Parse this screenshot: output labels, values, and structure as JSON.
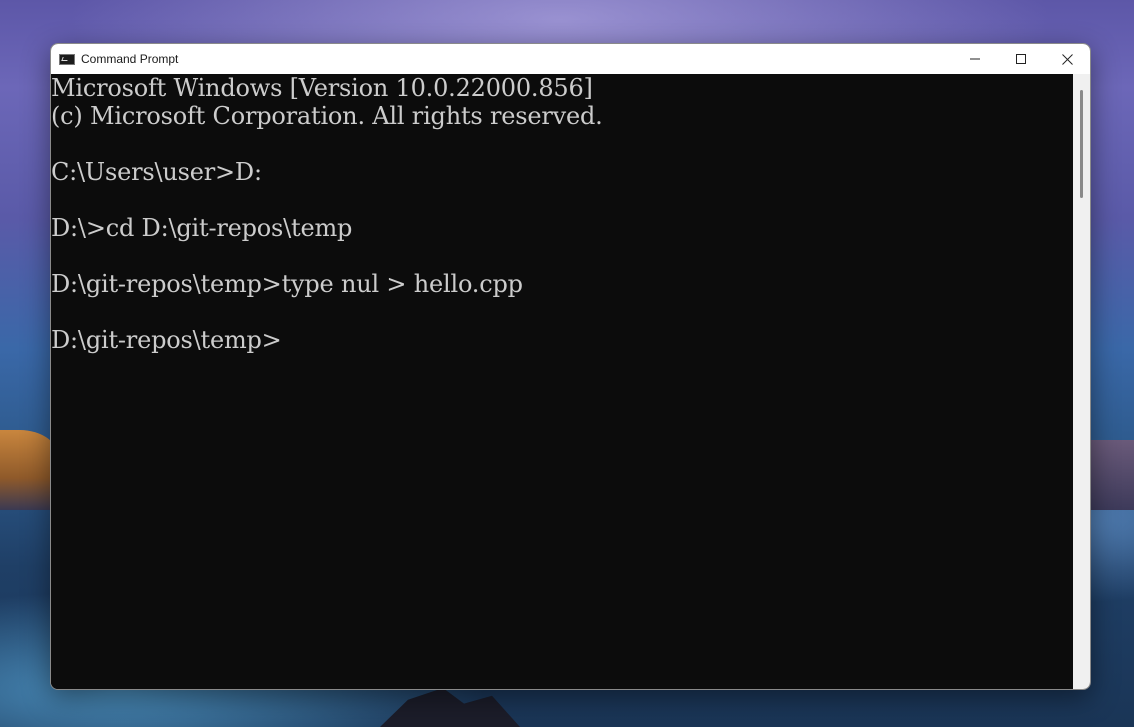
{
  "window": {
    "title": "Command Prompt",
    "app_icon": "command-prompt-icon"
  },
  "caption_buttons": {
    "minimize_icon": "minimize-icon",
    "maximize_icon": "maximize-icon",
    "close_icon": "close-icon"
  },
  "console": {
    "lines": [
      "Microsoft Windows [Version 10.0.22000.856]",
      "(c) Microsoft Corporation. All rights reserved.",
      "",
      "C:\\Users\\user>D:",
      "",
      "D:\\>cd D:\\git-repos\\temp",
      "",
      "D:\\git-repos\\temp>type nul > hello.cpp",
      "",
      "D:\\git-repos\\temp>"
    ],
    "text_color": "#cccccc",
    "background_color": "#0c0c0c"
  }
}
